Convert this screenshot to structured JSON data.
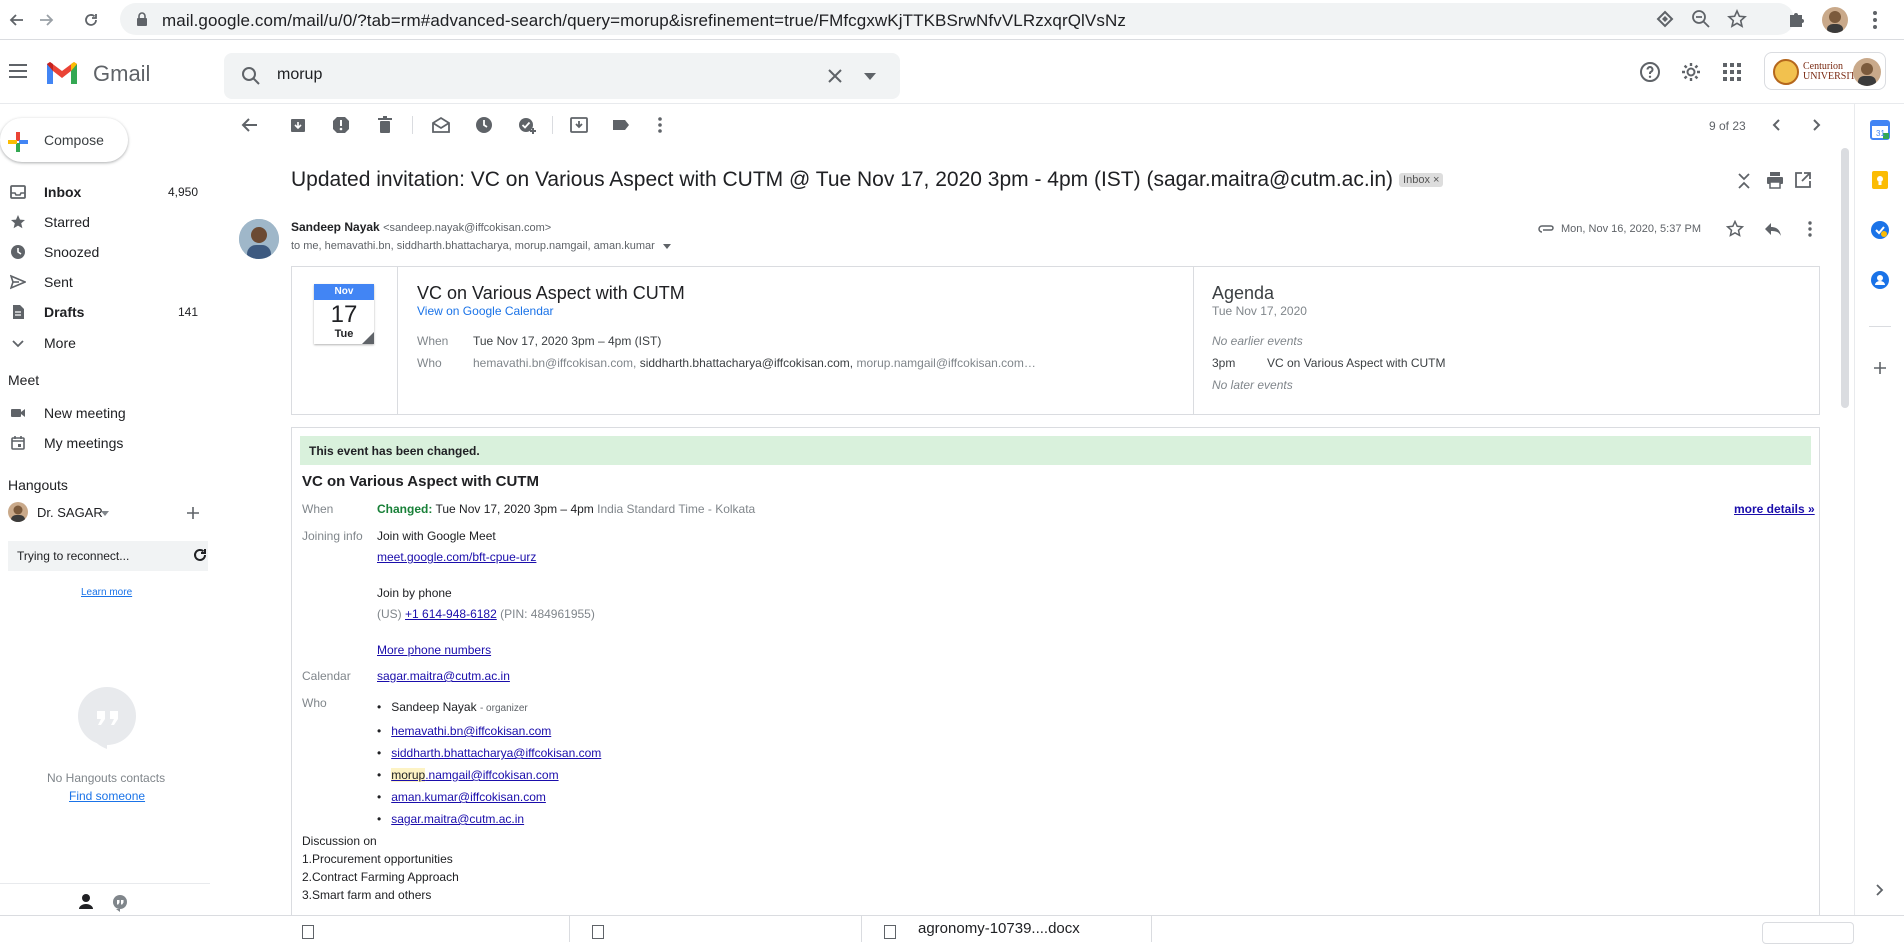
{
  "browser": {
    "url": "mail.google.com/mail/u/0/?tab=rm#advanced-search/query=morup&isrefinement=true/FMfcgxwKjTTKBSrwNfvVLRzxqrQlVsNz"
  },
  "gmail": {
    "logo_text": "Gmail",
    "search_query": "morup",
    "org_logo_text": "Centurion UNIVERSITY"
  },
  "sidebar": {
    "compose_label": "Compose",
    "items": [
      {
        "label": "Inbox",
        "count": "4,950"
      },
      {
        "label": "Starred",
        "count": ""
      },
      {
        "label": "Snoozed",
        "count": ""
      },
      {
        "label": "Sent",
        "count": ""
      },
      {
        "label": "Drafts",
        "count": "141"
      },
      {
        "label": "More",
        "count": ""
      }
    ],
    "meet_heading": "Meet",
    "meet_items": [
      "New meeting",
      "My meetings"
    ],
    "hangouts_heading": "Hangouts",
    "hangouts_user": "Dr. SAGAR",
    "reconnect_text": "Trying to reconnect...",
    "learn_more": "Learn more",
    "no_contacts": "No Hangouts contacts",
    "find_someone": "Find someone"
  },
  "toolbar": {
    "pagination": "9 of 23"
  },
  "email": {
    "subject": "Updated invitation: VC on Various Aspect with CUTM @ Tue Nov 17, 2020 3pm - 4pm (IST) (sagar.maitra@cutm.ac.in)",
    "label_badge": "Inbox",
    "sender_name": "Sandeep Nayak",
    "sender_email": "<sandeep.nayak@iffcokisan.com>",
    "recipients": "to me, hemavathi.bn, siddharth.bhattacharya, morup.namgail, aman.kumar",
    "date": "Mon, Nov 16, 2020, 5:37 PM"
  },
  "calendar_card": {
    "month": "Nov",
    "day": "17",
    "weekday": "Tue",
    "title": "VC on Various Aspect with CUTM",
    "view_link": "View on Google Calendar",
    "when_label": "When",
    "when_value": "Tue Nov 17, 2020 3pm – 4pm (IST)",
    "who_label": "Who",
    "who_first": "hemavathi.bn@iffcokisan.com,",
    "who_second": "siddharth.bhattacharya@iffcokisan.com,",
    "who_third": "morup.namgail@iffcokisan.com…",
    "agenda_title": "Agenda",
    "agenda_date": "Tue Nov 17, 2020",
    "no_earlier": "No earlier events",
    "agenda_time": "3pm",
    "agenda_event": "VC on Various Aspect with CUTM",
    "no_later": "No later events"
  },
  "invite": {
    "changed_banner": "This event has been changed.",
    "title": "VC on Various Aspect with CUTM",
    "when_label": "When",
    "changed_word": "Changed:",
    "when_value": "Tue Nov 17, 2020 3pm – 4pm",
    "timezone": "India Standard Time - Kolkata",
    "more_details": "more details »",
    "joining_label": "Joining info",
    "join_meet": "Join with Google Meet",
    "meet_link": "meet.google.com/bft-cpue-urz",
    "join_phone": "Join by phone",
    "phone_prefix": "(US)",
    "phone_number": "+1 614-948-6182",
    "pin": "(PIN: 484961955)",
    "more_phones": "More phone numbers",
    "calendar_label": "Calendar",
    "calendar_value": "sagar.maitra@cutm.ac.in",
    "who_label": "Who",
    "organizer_name": "Sandeep Nayak",
    "organizer_tag": "- organizer",
    "guest_1": "hemavathi.bn@iffcokisan.com",
    "guest_2": "siddharth.bhattacharya@iffcokisan.com",
    "guest_3_highlight": "morup",
    "guest_3_rest": ".namgail@iffcokisan.com",
    "guest_4": "aman.kumar@iffcokisan.com",
    "guest_5": "sagar.maitra@cutm.ac.in",
    "discussion_lines": [
      "Discussion on",
      "1.Procurement opportunities",
      "2.Contract Farming Approach",
      "3.Smart farm and others"
    ]
  },
  "downloads": {
    "file_label": "agronomy-10739....docx"
  },
  "colors": {
    "gmail_red": "#ea4335",
    "calendar_blue": "#4285f4",
    "changed_green_bg": "#d9f1dc",
    "changed_green_text": "#188038",
    "link_blue": "#1a0dab"
  }
}
